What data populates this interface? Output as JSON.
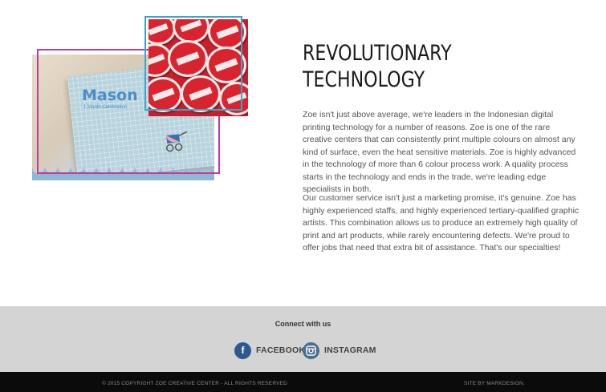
{
  "hero": {
    "headline_line1": "REVOLUTIONARY",
    "headline_line2": "TECHNOLOGY",
    "paragraph1": "Zoe isn't just above average, we're leaders in the Indonesian digital printing technology for a number of reasons. Zoe is one of the rare creative centers that can consistently print multiple colours on almost any kind of surface, even the heat sensitive materials. Zoe is highly advanced in the technology of more than  6 colour process work. A quality process starts in the technology and ends in the trade, we're leading edge specialists in both.",
    "paragraph2": "Our customer service isn't just a marketing promise, it's genuine. Zoe has highly experienced staffs, and highly experienced tertiary-qualified graphic artists. This combination allows us to produce an extremely high quality of print and art products, while rarely encountering defects. We're proud to offer jobs that need that extra bit of assistance. That's our specialties!",
    "images": {
      "book": {
        "title": "Mason",
        "subtitle": "1 Month Celebration"
      },
      "buttons": {
        "description_icon": "badge-buttons-photo"
      }
    },
    "colors": {
      "frame_magenta": "#c23b9c",
      "frame_cyan": "#3aa6cf"
    }
  },
  "footer": {
    "connect_title": "Connect with us",
    "social": [
      {
        "label": "FACEBOOK",
        "icon": "facebook-icon",
        "glyph": "f"
      },
      {
        "label": "INSTAGRAM",
        "icon": "instagram-icon",
        "glyph": "◘"
      }
    ],
    "copyright": "© 2015 COPYRIGHT ZOE CREATIVE CENTER - ALL RIGHTS RESERVED",
    "credit": "SITE BY MARKDESIGN."
  },
  "colors": {
    "footer_bg": "#d4d4d4",
    "bottom_bar_bg": "#0b0b0b",
    "facebook": "#2d5a8e",
    "instagram": "#4d6f8f"
  }
}
